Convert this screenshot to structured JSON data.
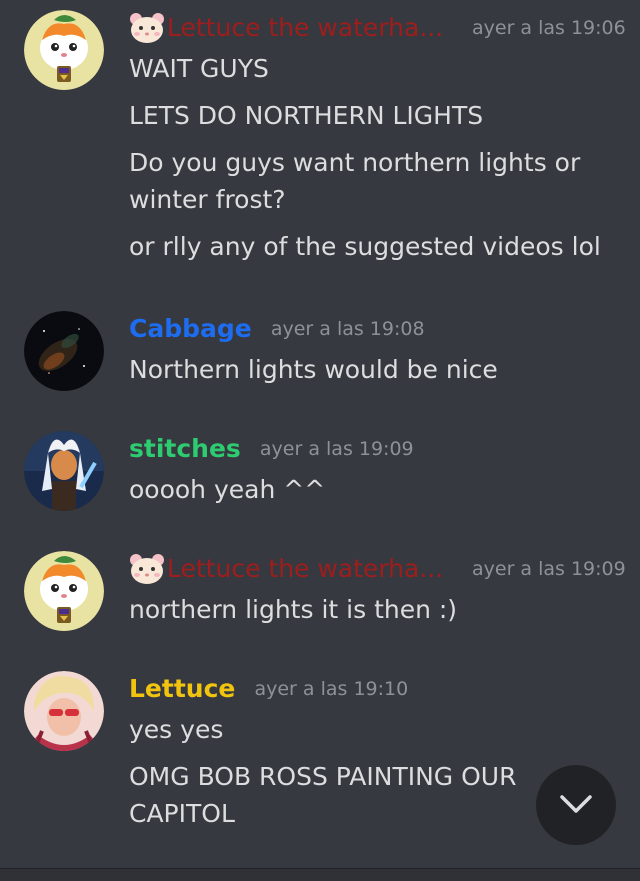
{
  "messages": [
    {
      "username": "Lettuce the waterha...",
      "timestamp": "ayer a las 19:06",
      "lines": [
        "WAIT GUYS",
        "LETS DO NORTHERN LIGHTS",
        "Do you guys want northern lights or winter frost?",
        "or rlly any of the suggested videos lol"
      ]
    },
    {
      "username": "Cabbage",
      "timestamp": "ayer a las 19:08",
      "lines": [
        "Northern lights would be nice"
      ]
    },
    {
      "username": "stitches",
      "timestamp": "ayer a las 19:09",
      "lines": [
        "ooooh yeah ^^"
      ]
    },
    {
      "username": "Lettuce the waterha...",
      "timestamp": "ayer a las 19:09",
      "lines": [
        "northern lights it is then :)"
      ]
    },
    {
      "username": "Lettuce",
      "timestamp": "ayer a las 19:10",
      "lines": [
        "yes yes",
        "OMG BOB ROSS PAINTING OUR CAPITOL"
      ]
    }
  ],
  "colors": {
    "background": "#36393f",
    "hamster_name": "#9e1d1d",
    "cabbage_name": "#1e6cf0",
    "stitches_name": "#2ecc71",
    "lettuce_name": "#f1c40f",
    "timestamp": "#8e9297"
  },
  "icons": {
    "hamster_emoji": "hamster-face-icon",
    "scroll_down": "chevron-down-icon"
  }
}
